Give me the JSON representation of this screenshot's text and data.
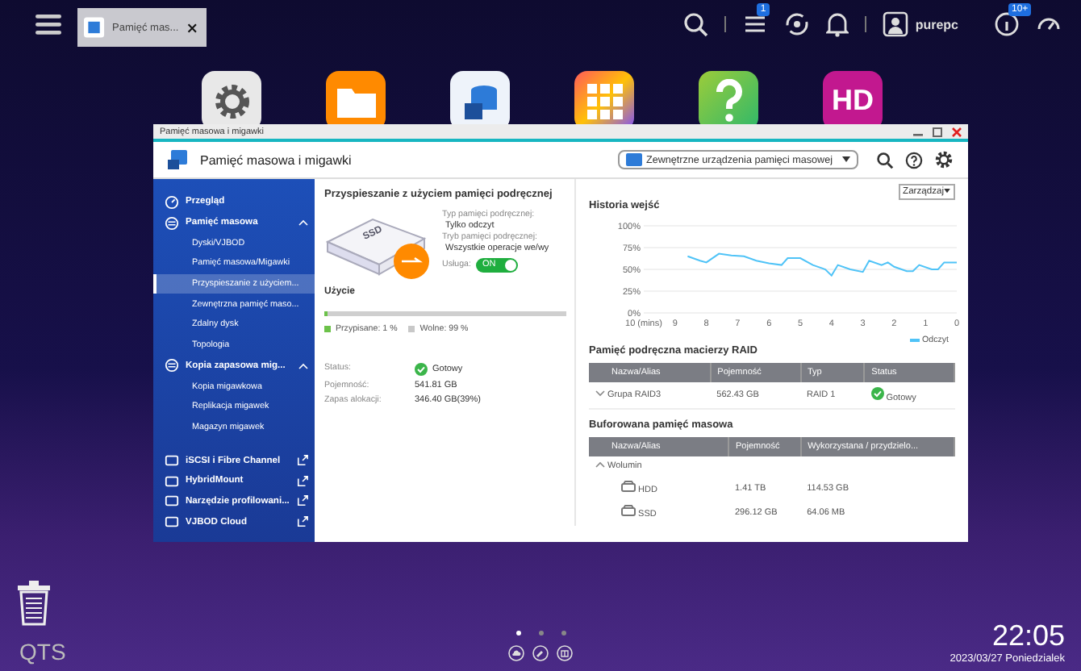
{
  "taskbar": {
    "tab_title": "Pamięć mas...",
    "tasks_badge": "1",
    "username": "purepc",
    "info_badge": "10+"
  },
  "desktop_apps": [
    {
      "kind": "settings"
    },
    {
      "kind": "files"
    },
    {
      "kind": "storage"
    },
    {
      "kind": "appcenter"
    },
    {
      "kind": "help"
    },
    {
      "kind": "hd",
      "text": "HD"
    }
  ],
  "window": {
    "title": "Pamięć masowa i migawki",
    "app_title": "Pamięć masowa i migawki",
    "device_select": "Zewnętrzne urządzenia pamięci masowej"
  },
  "sidebar": {
    "items": [
      {
        "label": "Przegląd",
        "selected": false
      },
      {
        "label": "Pamięć masowa",
        "expanded": true,
        "children": [
          {
            "label": "Dyski/VJBOD",
            "selected": false
          },
          {
            "label": "Pamięć masowa/Migawki",
            "selected": false
          },
          {
            "label": "Przyspieszanie z użyciem...",
            "selected": true
          },
          {
            "label": "Zewnętrzna pamięć maso...",
            "selected": false
          },
          {
            "label": "Zdalny dysk",
            "selected": false
          },
          {
            "label": "Topologia",
            "selected": false
          }
        ]
      },
      {
        "label": "Kopia zapasowa mig...",
        "expanded": true,
        "children": [
          {
            "label": "Kopia migawkowa",
            "selected": false
          },
          {
            "label": "Replikacja migawek",
            "selected": false
          },
          {
            "label": "Magazyn migawek",
            "selected": false
          }
        ]
      }
    ],
    "links": [
      {
        "label": "iSCSI i Fibre Channel"
      },
      {
        "label": "HybridMount"
      },
      {
        "label": "Narzędzie profilowani..."
      },
      {
        "label": "VJBOD Cloud"
      }
    ]
  },
  "cache_panel": {
    "title": "Przyspieszanie z użyciem pamięci podręcznej",
    "ssd_label": "SSD",
    "cache_type_label": "Typ pamięci podręcznej:",
    "cache_type": "Tylko odczyt",
    "cache_mode_label": "Tryb pamięci podręcznej:",
    "cache_mode": "Wszystkie operacje we/wy",
    "service_label": "Usługa:",
    "service_on": true,
    "service_text": "ON",
    "usage_title": "Użycie",
    "usage_bar": {
      "level": 0.01
    },
    "legend": [
      {
        "label": "Przypisane: 1 %",
        "color": "#6cc24a"
      },
      {
        "label": "Wolne: 99 %",
        "color": "#c8c8c8"
      }
    ],
    "details": [
      {
        "label": "Status:",
        "value": "Gotowy",
        "kind": "status"
      },
      {
        "label": "Pojemność:",
        "value": "541.81 GB",
        "kind": "text"
      },
      {
        "label": "Zapas alokacji:",
        "value": "346.40 GB(39%)",
        "kind": "text"
      }
    ]
  },
  "manage_button": "Zarządzaj",
  "history": {
    "title": "Historia wejść",
    "chart_data": {
      "type": "line",
      "x": [
        8.6,
        8.2,
        8,
        7.6,
        7.2,
        6.8,
        6.4,
        6,
        5.6,
        5.4,
        5,
        4.6,
        4.2,
        4,
        3.8,
        3.4,
        3,
        2.8,
        2.4,
        2.2,
        2,
        1.6,
        1.4,
        1.2,
        0.8,
        0.6,
        0.4,
        0
      ],
      "series": [
        {
          "name": "Odczyt",
          "color": "#4fc3f7",
          "values": [
            65,
            60,
            58,
            68,
            66,
            65,
            60,
            57,
            55,
            63,
            63,
            55,
            50,
            43,
            55,
            50,
            47,
            60,
            55,
            58,
            53,
            48,
            48,
            55,
            50,
            50,
            58,
            58
          ]
        }
      ],
      "xlim": [
        10,
        0
      ],
      "ylim": [
        0,
        100
      ],
      "grid": true,
      "xticks": [
        {
          "value": 10,
          "label": "10 (mins)"
        },
        9,
        8,
        7,
        6,
        5,
        4,
        3,
        2,
        1,
        0
      ],
      "yticks": [
        {
          "value": 0,
          "label": "0%"
        },
        {
          "value": 25,
          "label": "25%"
        },
        {
          "value": 50,
          "label": "50%"
        },
        {
          "value": 75,
          "label": "75%"
        },
        {
          "value": 100,
          "label": "100%"
        }
      ]
    }
  },
  "raid_cache": {
    "title": "Pamięć podręczna macierzy RAID",
    "columns": [
      "Nazwa/Alias",
      "Pojemność",
      "Typ",
      "Status"
    ],
    "rows": [
      {
        "name": "Grupa RAID3",
        "capacity": "562.43 GB",
        "type": "RAID 1",
        "status": "Gotowy",
        "expanded": false
      }
    ]
  },
  "buffered": {
    "title": "Buforowana pamięć masowa",
    "columns": [
      "Nazwa/Alias",
      "Pojemność",
      "Wykorzystana / przydzielo..."
    ],
    "rows": [
      {
        "name": "Wolumin",
        "expanded": true,
        "children": [
          {
            "name": "HDD",
            "capacity": "1.41 TB",
            "used": "114.53 GB"
          },
          {
            "name": "SSD",
            "capacity": "296.12 GB",
            "used": "64.06 MB"
          }
        ]
      }
    ]
  },
  "dock": {
    "logo": "QTS",
    "pages": [
      {
        "selected": true
      },
      {
        "selected": false
      },
      {
        "selected": false
      }
    ]
  },
  "clock": {
    "time": "22:05",
    "date": "2023/03/27 Poniedzialek"
  }
}
